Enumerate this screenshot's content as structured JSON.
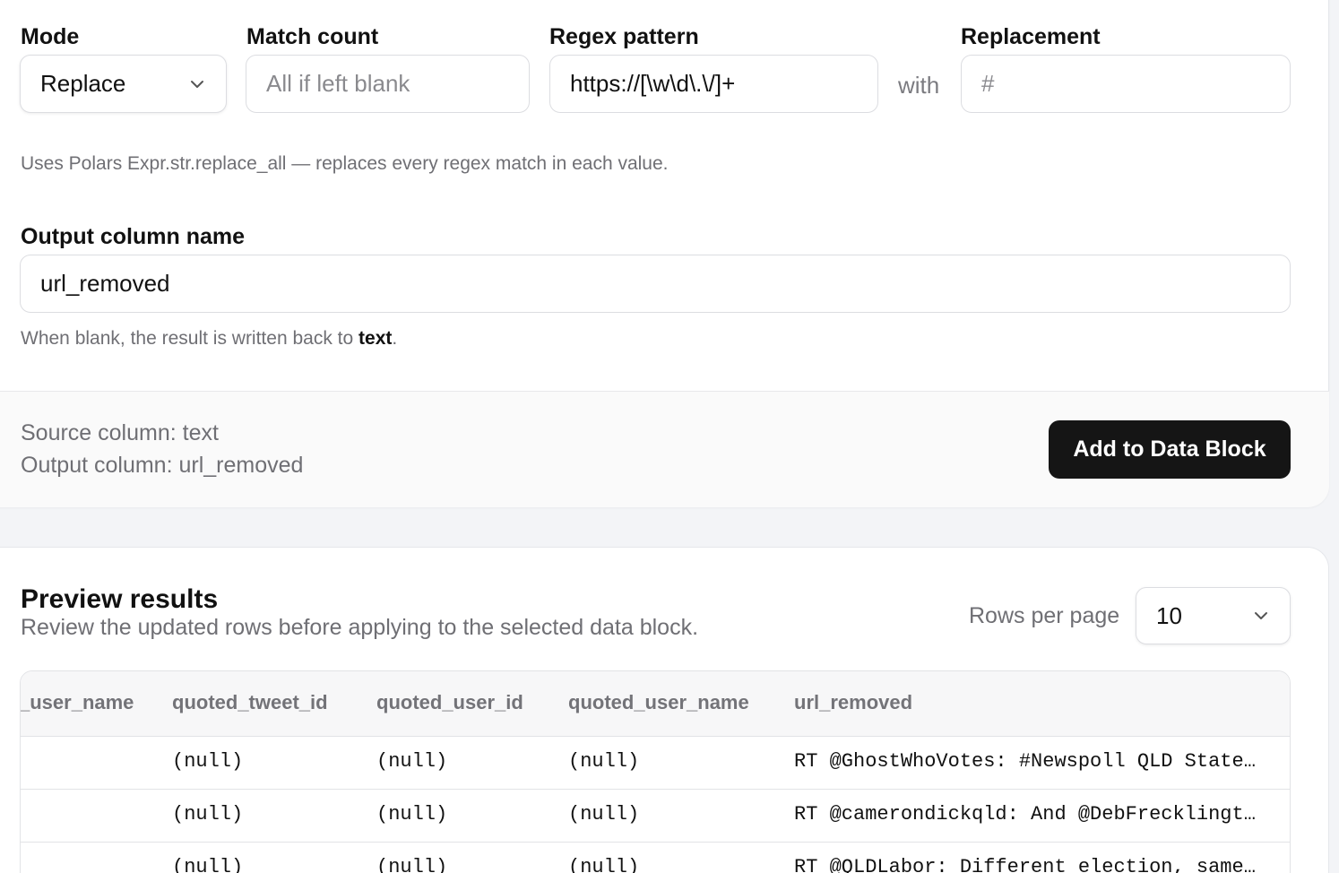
{
  "form": {
    "mode": {
      "label": "Mode",
      "value": "Replace"
    },
    "match_count": {
      "label": "Match count",
      "value": "",
      "placeholder": "All if left blank"
    },
    "regex": {
      "label": "Regex pattern",
      "value": "https://[\\w\\d\\.\\/]+"
    },
    "with_text": "with",
    "replacement": {
      "label": "Replacement",
      "value": "",
      "placeholder": "#"
    },
    "help_text": "Uses Polars Expr.str.replace_all — replaces every regex match in each value.",
    "output": {
      "label": "Output column name",
      "value": "url_removed",
      "help_prefix": "When blank, the result is written back to ",
      "help_column": "text",
      "help_suffix": "."
    }
  },
  "summary": {
    "source": "Source column: text",
    "output": "Output column: url_removed",
    "add_button": "Add to Data Block"
  },
  "preview": {
    "title": "Preview results",
    "subtitle": "Review the updated rows before applying to the selected data block.",
    "rows_per_page_label": "Rows per page",
    "rows_per_page": "10",
    "columns": [
      "_user_name",
      "quoted_tweet_id",
      "quoted_user_id",
      "quoted_user_name",
      "url_removed"
    ],
    "rows": [
      [
        "",
        "(null)",
        "(null)",
        "(null)",
        "RT @GhostWhoVotes: #Newspoll QLD State Voting Intention"
      ],
      [
        "",
        "(null)",
        "(null)",
        "(null)",
        "RT @camerondickqld: And @DebFrecklington has"
      ],
      [
        "",
        "(null)",
        "(null)",
        "(null)",
        "RT @QLDLabor: Different election, same LNP"
      ]
    ]
  }
}
